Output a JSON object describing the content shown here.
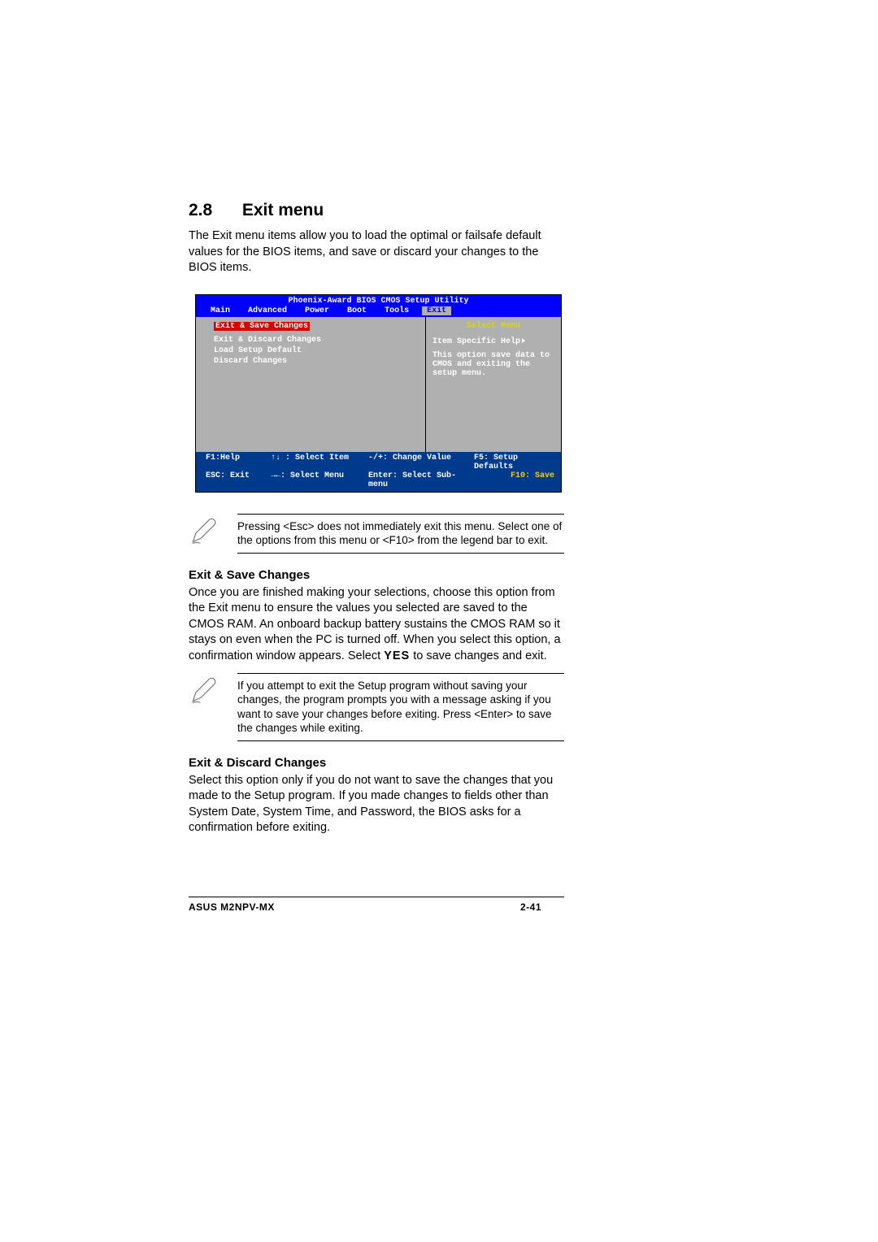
{
  "section": {
    "number": "2.8",
    "title": "Exit menu"
  },
  "intro": "The Exit menu items allow you to load the optimal or failsafe default values for the BIOS items, and save or discard your changes to the BIOS items.",
  "bios": {
    "title": "Phoenix-Award BIOS CMOS Setup Utility",
    "tabs": [
      "Main",
      "Advanced",
      "Power",
      "Boot",
      "Tools",
      "Exit"
    ],
    "selected_tab": "Exit",
    "items": [
      "Exit & Save Changes",
      "Exit & Discard Changes",
      "Load Setup Default",
      "Discard Changes"
    ],
    "highlighted_item": "Exit & Save Changes",
    "help_panel": {
      "header": "Select Menu",
      "subheader": "Item Specific Help",
      "text": "This option save data to CMOS and exiting the setup menu."
    },
    "footer": {
      "r1c1": "F1:Help",
      "r1c2": "↑↓ : Select Item",
      "r1c3": "-/+: Change Value",
      "r1c4": "F5: Setup Defaults",
      "r2c1": "ESC: Exit",
      "r2c2": "→←: Select Menu",
      "r2c3": "Enter: Select Sub-menu",
      "r2c4": "F10: Save"
    }
  },
  "note1": "Pressing <Esc> does not immediately exit this menu. Select one of the options from this menu or <F10> from the legend bar to exit.",
  "subsections": {
    "s1": {
      "heading": "Exit & Save Changes",
      "body_before_yes": "Once you are finished making your selections, choose this option from the Exit menu to ensure the values you selected are saved to the CMOS RAM. An onboard backup battery sustains the CMOS RAM so it stays on even when the PC is turned off. When you select this option, a confirmation window appears. Select ",
      "yes": "YES",
      "body_after_yes": " to save changes and exit."
    },
    "s2": {
      "heading": "Exit & Discard Changes",
      "body": "Select this option only if you do not want to save the changes that you made to the Setup program. If you made changes to fields other than System Date, System Time, and Password, the BIOS asks for a confirmation before exiting."
    }
  },
  "note2": "If you attempt to exit the Setup program without saving your changes, the program prompts you with a message asking if you want to save your changes before exiting. Press <Enter>  to save the  changes while exiting.",
  "footer": {
    "model": "ASUS M2NPV-MX",
    "page": "2-41"
  }
}
